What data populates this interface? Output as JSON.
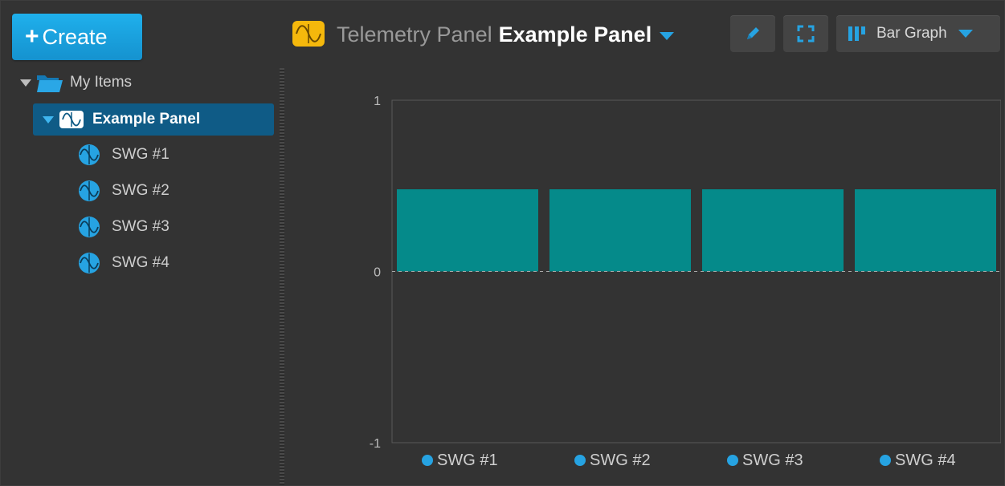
{
  "left": {
    "create_label": "Create",
    "tree": {
      "root_label": "My Items",
      "selected_label": "Example Panel",
      "children": [
        "SWG #1",
        "SWG #2",
        "SWG #3",
        "SWG #4"
      ]
    }
  },
  "header": {
    "type_label": "Telemetry Panel",
    "name_label": "Example Panel",
    "view_label": "Bar Graph"
  },
  "colors": {
    "accent": "#26a3e2",
    "bar": "#058a8a",
    "background": "#333333",
    "panel_icon": "#f5b80c"
  },
  "icons": {
    "create": "plus-icon",
    "root": "folder-icon",
    "panel": "telemetry-panel-icon",
    "item": "sine-wave-generator-icon",
    "edit": "pencil-icon",
    "fullscreen": "expand-icon",
    "view": "bar-graph-icon"
  },
  "chart_data": {
    "type": "bar",
    "categories": [
      "SWG #1",
      "SWG #2",
      "SWG #3",
      "SWG #4"
    ],
    "values": [
      0.48,
      0.48,
      0.48,
      0.48
    ],
    "yticks": [
      "1",
      "0",
      "-1"
    ],
    "ylim": [
      -1,
      1
    ],
    "title": "",
    "xlabel": "",
    "ylabel": "",
    "grid": false,
    "zero_line": "dashed"
  }
}
